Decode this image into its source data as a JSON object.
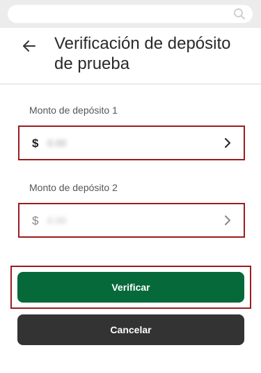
{
  "colors": {
    "primary_green": "#05693a",
    "highlight_red": "#9b1c20",
    "cancel_dark": "#333333"
  },
  "icons": {
    "search": "search-icon",
    "back": "back-arrow-icon",
    "chevron": "chevron-right-icon"
  },
  "header": {
    "title": "Verificación de depósito de prueba"
  },
  "deposit_1": {
    "label": "Monto de depósito 1",
    "currency": "$",
    "value": "0.00"
  },
  "deposit_2": {
    "label": "Monto de depósito 2",
    "currency": "$",
    "value": "0.00"
  },
  "actions": {
    "verify_label": "Verificar",
    "cancel_label": "Cancelar"
  }
}
